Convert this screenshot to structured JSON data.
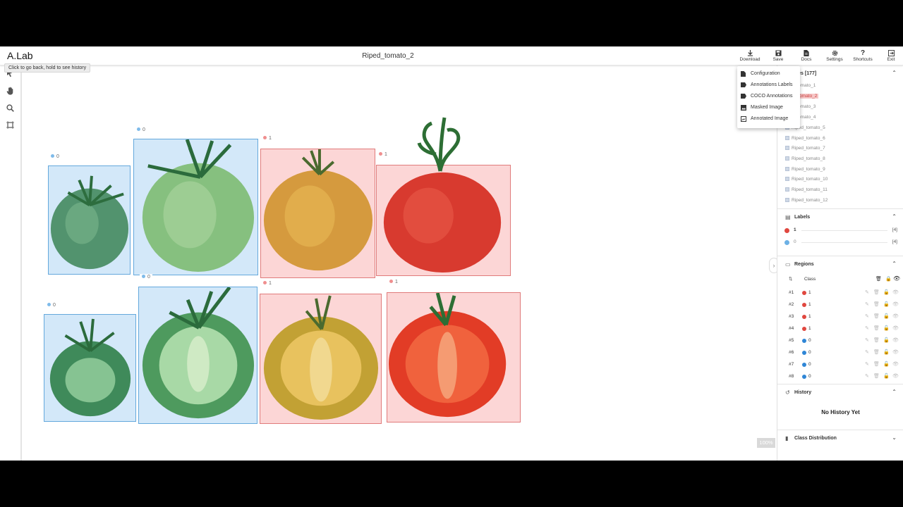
{
  "app": {
    "name": "A.Lab",
    "title": "Riped_tomato_2",
    "tooltip": "Click to go back, hold to see history"
  },
  "toolbar": [
    {
      "label": "Download",
      "icon": "download-icon"
    },
    {
      "label": "Save",
      "icon": "save-icon"
    },
    {
      "label": "Docs",
      "icon": "docs-icon"
    },
    {
      "label": "Settings",
      "icon": "gear-icon"
    },
    {
      "label": "Shortcuts",
      "icon": "question-icon"
    },
    {
      "label": "Exit",
      "icon": "exit-icon"
    }
  ],
  "left_tools": [
    "pointer-icon",
    "hand-icon",
    "zoom-icon",
    "create-box-icon"
  ],
  "download_menu": [
    {
      "label": "Configuration",
      "icon": "file-icon"
    },
    {
      "label": "Annotations Labels",
      "icon": "label-icon"
    },
    {
      "label": "COCO Annotations",
      "icon": "label-icon"
    },
    {
      "label": "Masked Image",
      "icon": "image-icon"
    },
    {
      "label": "Annotated Image",
      "icon": "annotated-image-icon"
    }
  ],
  "images_panel": {
    "title": "ages [177]",
    "items": [
      {
        "label": "d_tomato_1"
      },
      {
        "label": "d_tomato_2",
        "active": true
      },
      {
        "label": "d_tomato_3"
      },
      {
        "label": "d_tomato_4"
      },
      {
        "label": "Riped_tomato_5"
      },
      {
        "label": "Riped_tomato_6"
      },
      {
        "label": "Riped_tomato_7"
      },
      {
        "label": "Riped_tomato_8"
      },
      {
        "label": "Riped_tomato_9"
      },
      {
        "label": "Riped_tomato_10"
      },
      {
        "label": "Riped_tomato_11"
      },
      {
        "label": "Riped_tomato_12"
      }
    ]
  },
  "labels_panel": {
    "title": "Labels",
    "items": [
      {
        "name": "1",
        "count": "[4]",
        "color": "#e0473f"
      },
      {
        "name": "0",
        "count": "[4]",
        "color": "#6db1e5"
      }
    ]
  },
  "regions_panel": {
    "title": "Regions",
    "class_header": "Class",
    "rows": [
      {
        "id": "#1",
        "class": "1",
        "color": "#e0473f"
      },
      {
        "id": "#2",
        "class": "1",
        "color": "#e0473f"
      },
      {
        "id": "#3",
        "class": "1",
        "color": "#e0473f"
      },
      {
        "id": "#4",
        "class": "1",
        "color": "#e0473f"
      },
      {
        "id": "#5",
        "class": "0",
        "color": "#2f86d6"
      },
      {
        "id": "#6",
        "class": "0",
        "color": "#2f86d6"
      },
      {
        "id": "#7",
        "class": "0",
        "color": "#2f86d6"
      },
      {
        "id": "#8",
        "class": "0",
        "color": "#2f86d6"
      }
    ]
  },
  "history_panel": {
    "title": "History",
    "empty_text": "No History Yet"
  },
  "class_distribution": {
    "title": "Class Distribution"
  },
  "canvas": {
    "zoom": "100%",
    "boxes": [
      {
        "label": "0",
        "class": "blue",
        "dot": "#7fbbea"
      },
      {
        "label": "0",
        "class": "blue",
        "dot": "#7fbbea"
      },
      {
        "label": "1",
        "class": "red",
        "dot": "#ef8f8f"
      },
      {
        "label": "1",
        "class": "red",
        "dot": "#ef8f8f"
      },
      {
        "label": "0",
        "class": "blue",
        "dot": "#7fbbea"
      },
      {
        "label": "0",
        "class": "blue",
        "dot": "#7fbbea"
      },
      {
        "label": "1",
        "class": "red",
        "dot": "#ef8f8f"
      },
      {
        "label": "1",
        "class": "red",
        "dot": "#ef8f8f"
      }
    ]
  },
  "colors": {
    "blue_box": "#64a8dc",
    "red_box": "#e07b7b",
    "active_image": "#f6c7c7"
  }
}
